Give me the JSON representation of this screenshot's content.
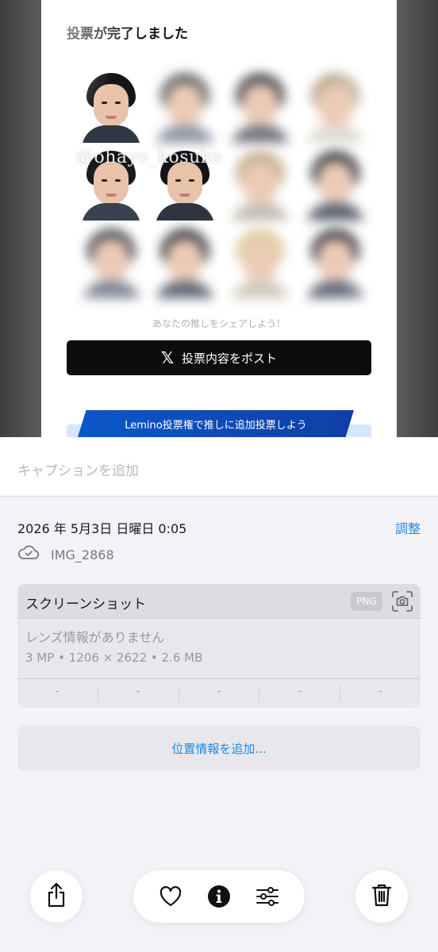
{
  "screenshot": {
    "title": "投票が完了しました",
    "watermark": "@ohayo_kosuke",
    "share_hint": "あなたの推しをシェアしよう！",
    "post_button": "投票内容をポスト",
    "post_icon": "x-logo-icon",
    "promo_banner": "Lemino投票権で推しに追加投票しよう"
  },
  "caption": {
    "placeholder": "キャプションを追加"
  },
  "info": {
    "date": "2026 年 5月3日 日曜日 0:05",
    "adjust_label": "調整",
    "cloud_icon": "cloud-check-icon",
    "file_name": "IMG_2868"
  },
  "card": {
    "title": "スクリーンショット",
    "format_badge": "PNG",
    "camera_icon": "camera-viewfinder-icon",
    "lens_info": "レンズ情報がありません",
    "specs": "3 MP • 1206 × 2622 • 2.6 MB",
    "exif_values": [
      "-",
      "-",
      "-",
      "-",
      "-"
    ]
  },
  "location_button": "位置情報を追加...",
  "toolbar": {
    "share_icon": "share-icon",
    "favorite_icon": "heart-icon",
    "info_icon": "info-icon",
    "adjust_icon": "sliders-icon",
    "delete_icon": "trash-icon"
  },
  "colors": {
    "accent": "#1f8ae0",
    "background": "#f2f2f7",
    "card": "#e7e7ec",
    "promo": "#0b57c9"
  }
}
